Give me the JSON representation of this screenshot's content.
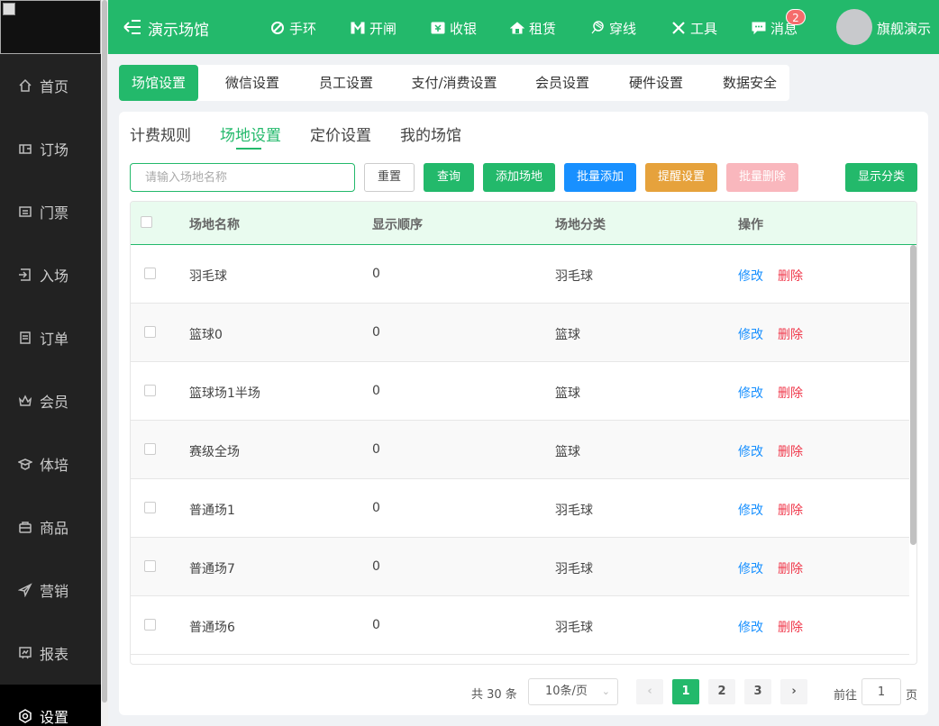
{
  "sidebar": {
    "items": [
      {
        "label": "首页",
        "icon": "home-icon"
      },
      {
        "label": "订场",
        "icon": "booking-icon"
      },
      {
        "label": "门票",
        "icon": "ticket-icon"
      },
      {
        "label": "入场",
        "icon": "entry-icon"
      },
      {
        "label": "订单",
        "icon": "order-icon"
      },
      {
        "label": "会员",
        "icon": "member-icon"
      },
      {
        "label": "体培",
        "icon": "training-icon"
      },
      {
        "label": "商品",
        "icon": "goods-icon"
      },
      {
        "label": "营销",
        "icon": "marketing-icon"
      },
      {
        "label": "报表",
        "icon": "report-icon"
      },
      {
        "label": "设置",
        "icon": "settings-icon"
      }
    ]
  },
  "topbar": {
    "title": "演示场馆",
    "items": [
      {
        "label": "手环",
        "icon": "wristband-icon"
      },
      {
        "label": "开闸",
        "icon": "gate-icon"
      },
      {
        "label": "收银",
        "icon": "cashier-icon"
      },
      {
        "label": "租赁",
        "icon": "rental-icon"
      },
      {
        "label": "穿线",
        "icon": "stringing-icon"
      },
      {
        "label": "工具",
        "icon": "tools-icon"
      },
      {
        "label": "消息",
        "icon": "message-icon"
      }
    ],
    "message_count": "2",
    "user_name": "旗舰演示"
  },
  "settings_tabs": [
    "场馆设置",
    "微信设置",
    "员工设置",
    "支付/消费设置",
    "会员设置",
    "硬件设置",
    "数据安全"
  ],
  "sub_tabs": [
    "计费规则",
    "场地设置",
    "定价设置",
    "我的场馆"
  ],
  "toolbar": {
    "search_placeholder": "请输入场地名称",
    "reset": "重置",
    "query": "查询",
    "add": "添加场地",
    "batch_add": "批量添加",
    "reminder": "提醒设置",
    "batch_delete": "批量删除",
    "show_category": "显示分类"
  },
  "table": {
    "columns": [
      "场地名称",
      "显示顺序",
      "场地分类",
      "操作"
    ],
    "edit_label": "修改",
    "delete_label": "删除",
    "rows": [
      {
        "name": "羽毛球",
        "order": "0",
        "category": "羽毛球"
      },
      {
        "name": "篮球0",
        "order": "0",
        "category": "篮球"
      },
      {
        "name": "篮球场1半场",
        "order": "0",
        "category": "篮球"
      },
      {
        "name": "赛级全场",
        "order": "0",
        "category": "篮球"
      },
      {
        "name": "普通场1",
        "order": "0",
        "category": "羽毛球"
      },
      {
        "name": "普通场7",
        "order": "0",
        "category": "羽毛球"
      },
      {
        "name": "普通场6",
        "order": "0",
        "category": "羽毛球"
      }
    ]
  },
  "pagination": {
    "total": "共 30 条",
    "page_size": "10条/页",
    "pages": [
      "1",
      "2",
      "3"
    ],
    "prev": "‹",
    "next": "›",
    "goto_label": "前往",
    "goto_value": "1",
    "goto_suffix": "页"
  },
  "colors": {
    "primary": "#23b96b",
    "blue": "#1890ff",
    "orange": "#e6a23c",
    "danger": "#f0384b"
  }
}
